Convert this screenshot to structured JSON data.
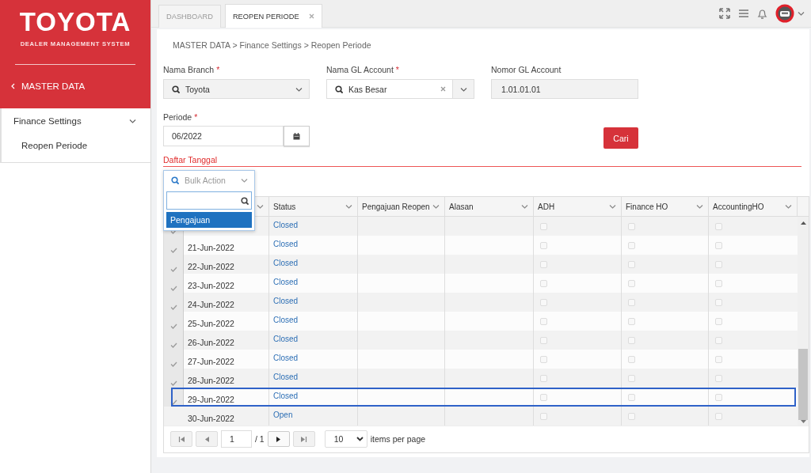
{
  "sidebar": {
    "logo": "TOYOTA",
    "subtitle": "DEALER MANAGEMENT SYSTEM",
    "back_label": "MASTER DATA",
    "items": [
      {
        "label": "Finance Settings",
        "expanded": true,
        "children": [
          {
            "label": "Reopen Periode"
          }
        ]
      }
    ]
  },
  "tabs": [
    {
      "label": "DASHBOARD",
      "selected": false,
      "closable": false
    },
    {
      "label": "REOPEN PERIODE",
      "selected": true,
      "closable": true
    }
  ],
  "breadcrumb": "MASTER DATA > Finance Settings > Reopen Periode",
  "form": {
    "fields": [
      {
        "kind": "select",
        "label": "Nama Branch",
        "required_mark": "*",
        "value": "Toyota"
      },
      {
        "kind": "combo",
        "label": "Nama GL Account",
        "required_mark": "*",
        "value": "Kas Besar"
      },
      {
        "kind": "readonly",
        "label": "Nomor GL Account",
        "value": "1.01.01.01"
      }
    ],
    "periode": {
      "label": "Periode",
      "required_mark": "*",
      "value": "06/2022"
    },
    "search_button": "Cari"
  },
  "section_title": "Daftar Tanggal",
  "bulk_action": {
    "placeholder": "Bulk Action",
    "options": [
      {
        "label": "Pengajuan",
        "selected": true
      }
    ]
  },
  "table": {
    "columns": [
      "Status",
      "Pengajuan Reopen",
      "Alasan",
      "ADH",
      "Finance HO",
      "AccountingHO"
    ],
    "rows": [
      {
        "status": "Closed",
        "selectable": true,
        "highlighted": false,
        "adh": false,
        "finance_ho": false,
        "accounting_ho": false
      },
      {
        "date": "21-Jun-2022",
        "status": "Closed",
        "selectable": true,
        "highlighted": false,
        "adh": false,
        "finance_ho": false,
        "accounting_ho": false
      },
      {
        "date": "22-Jun-2022",
        "status": "Closed",
        "selectable": true,
        "highlighted": false,
        "adh": false,
        "finance_ho": false,
        "accounting_ho": false
      },
      {
        "date": "23-Jun-2022",
        "status": "Closed",
        "selectable": true,
        "highlighted": false,
        "adh": false,
        "finance_ho": false,
        "accounting_ho": false
      },
      {
        "date": "24-Jun-2022",
        "status": "Closed",
        "selectable": true,
        "highlighted": false,
        "adh": false,
        "finance_ho": false,
        "accounting_ho": false
      },
      {
        "date": "25-Jun-2022",
        "status": "Closed",
        "selectable": true,
        "highlighted": false,
        "adh": false,
        "finance_ho": false,
        "accounting_ho": false
      },
      {
        "date": "26-Jun-2022",
        "status": "Closed",
        "selectable": true,
        "highlighted": false,
        "adh": false,
        "finance_ho": false,
        "accounting_ho": false
      },
      {
        "date": "27-Jun-2022",
        "status": "Closed",
        "selectable": true,
        "highlighted": false,
        "adh": false,
        "finance_ho": false,
        "accounting_ho": false
      },
      {
        "date": "28-Jun-2022",
        "status": "Closed",
        "selectable": true,
        "highlighted": false,
        "adh": false,
        "finance_ho": false,
        "accounting_ho": false
      },
      {
        "date": "29-Jun-2022",
        "status": "Closed",
        "selectable": true,
        "highlighted": true,
        "adh": false,
        "finance_ho": false,
        "accounting_ho": false
      },
      {
        "date": "30-Jun-2022",
        "status": "Open",
        "selectable": false,
        "highlighted": false,
        "adh": false,
        "finance_ho": false,
        "accounting_ho": false
      }
    ]
  },
  "pager": {
    "page": "1",
    "total": "/ 1",
    "page_size": "10",
    "label": "items per page"
  }
}
